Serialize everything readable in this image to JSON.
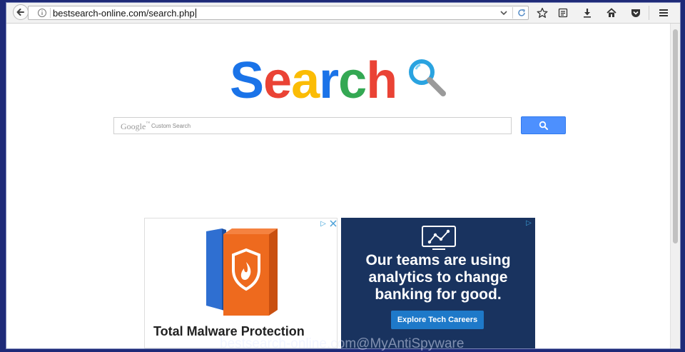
{
  "browser": {
    "url": "bestsearch-online.com/search.php"
  },
  "logo": {
    "letters": [
      "S",
      "e",
      "a",
      "r",
      "c",
      "h"
    ],
    "colors": [
      "#1a73e8",
      "#ea4335",
      "#fbbc05",
      "#1a73e8",
      "#34a853",
      "#ea4335"
    ]
  },
  "search": {
    "brand": "Google",
    "placeholder": "Custom Search"
  },
  "ads": {
    "left": {
      "title": "Total Malware Protection"
    },
    "right": {
      "headline": "Our teams are using analytics to change banking for good.",
      "button_label": "Explore Tech Careers"
    }
  },
  "watermark": "bestsearch-online.com@MyAntiSpyware",
  "colors": {
    "search_button": "#4d90fe",
    "ad_background": "#19335f"
  }
}
